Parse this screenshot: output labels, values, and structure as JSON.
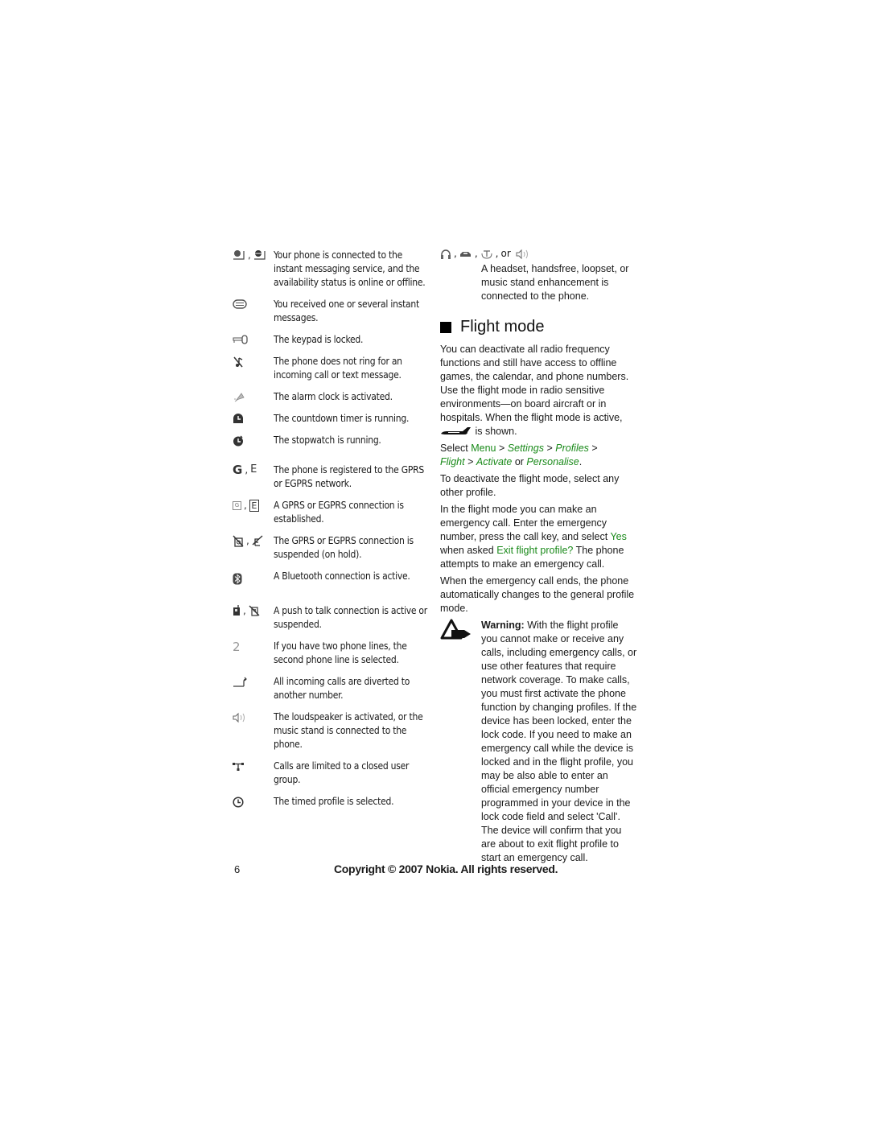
{
  "left_entries": [
    {
      "icons": [
        "im-online-icon",
        "im-offline-icon"
      ],
      "text": "Your phone is connected to the instant messaging service, and the availability status is online or offline."
    },
    {
      "icons": [
        "instant-message-icon"
      ],
      "text": "You received one or several instant messages."
    },
    {
      "icons": [
        "keypad-locked-icon"
      ],
      "text": "The keypad is locked."
    },
    {
      "icons": [
        "silent-icon"
      ],
      "text": "The phone does not ring for an incoming call or text message."
    },
    {
      "icons": [
        "alarm-clock-icon"
      ],
      "text": "The alarm clock is activated."
    },
    {
      "icons": [
        "countdown-timer-icon"
      ],
      "text": "The countdown timer is running."
    },
    {
      "icons": [
        "stopwatch-icon"
      ],
      "text": "The stopwatch is running."
    },
    {
      "icons": [
        "gprs-registered-icon",
        "egprs-registered-icon"
      ],
      "icon_text": [
        "G",
        "E"
      ],
      "text": "The phone is registered to the GPRS or EGPRS network."
    },
    {
      "icons": [
        "gprs-connected-icon",
        "egprs-connected-icon"
      ],
      "icon_text": [
        "G",
        "E"
      ],
      "text": "A GPRS or EGPRS connection is established."
    },
    {
      "icons": [
        "gprs-suspended-icon",
        "egprs-suspended-icon"
      ],
      "text": "The GPRS or EGPRS connection is suspended (on hold)."
    },
    {
      "icons": [
        "bluetooth-icon"
      ],
      "text": "A Bluetooth connection is active."
    },
    {
      "icons": [
        "ptt-active-icon",
        "ptt-suspended-icon"
      ],
      "text": "A push to talk connection is active or suspended."
    },
    {
      "icons": [
        "line-two-icon"
      ],
      "icon_text": [
        "2"
      ],
      "text": "If you have two phone lines, the second phone line is selected."
    },
    {
      "icons": [
        "call-divert-icon"
      ],
      "text": "All incoming calls are diverted to another number."
    },
    {
      "icons": [
        "loudspeaker-icon"
      ],
      "text": "The loudspeaker is activated, or the music stand is connected to the phone."
    },
    {
      "icons": [
        "closed-user-group-icon"
      ],
      "text": "Calls are limited to a closed user group."
    },
    {
      "icons": [
        "timed-profile-icon"
      ],
      "text": "The timed profile is selected."
    }
  ],
  "right": {
    "enhancement": {
      "icons": [
        "headset-icon",
        "handsfree-icon",
        "loopset-icon",
        "music-stand-icon"
      ],
      "or_label": "or",
      "text": "A headset, handsfree, loopset, or music stand enhancement is connected to the phone."
    },
    "heading": "Flight mode",
    "intro": "You can deactivate all radio frequency functions and still have access to offline games, the calendar, and phone numbers. Use the flight mode in radio sensitive environments—on board aircraft or in hospitals. When the flight mode is active,",
    "intro_suffix": "is shown.",
    "select_path": {
      "prefix": "Select",
      "menu": "Menu",
      "sep": ">",
      "settings": "Settings",
      "profiles": "Profiles",
      "flight": "Flight",
      "activate": "Activate",
      "or": "or",
      "personalise": "Personalise",
      "end": "."
    },
    "deactivate": "To deactivate the flight mode, select any other profile.",
    "emergency_1": "In the flight mode you can make an emergency call. Enter the emergency number, press the call key, and select",
    "yes_label": "Yes",
    "emergency_2": "when asked",
    "exit_prompt": "Exit flight profile?",
    "emergency_3": "The phone attempts to make an emergency call.",
    "ends": "When the emergency call ends, the phone automatically changes to the general profile mode.",
    "warning_label": "Warning:",
    "warning_text": "With the flight profile you cannot make or receive any calls, including emergency calls, or use other features that require network coverage. To make calls, you must first activate the phone function by changing profiles. If the device has been locked, enter the lock code. If you need to make an emergency call while the device is locked and in the flight profile, you may be also able to enter an official emergency number programmed in your device in the lock code field and select 'Call'. The device will confirm that you are about to exit flight profile to start an emergency call."
  },
  "footer": {
    "page_number": "6",
    "copyright": "Copyright © 2007 Nokia. All rights reserved."
  },
  "colors": {
    "link_green": "#1a8a1a",
    "text": "#1a1a1a"
  }
}
